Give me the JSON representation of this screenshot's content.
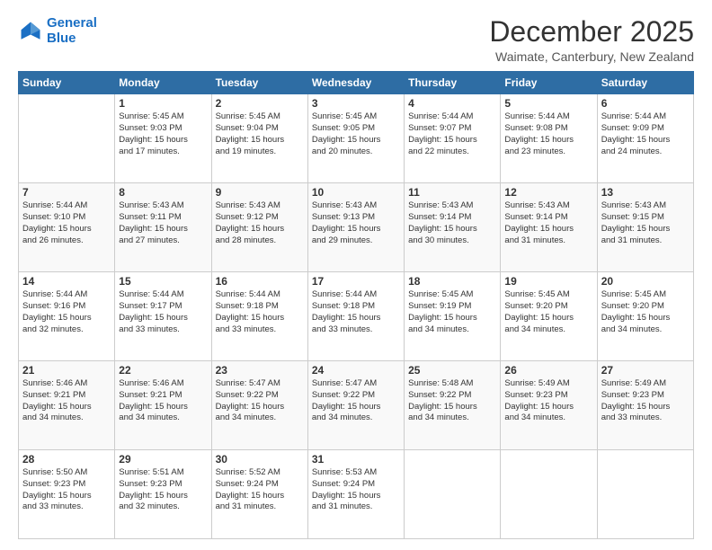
{
  "header": {
    "logo_line1": "General",
    "logo_line2": "Blue",
    "title": "December 2025",
    "subtitle": "Waimate, Canterbury, New Zealand"
  },
  "days_of_week": [
    "Sunday",
    "Monday",
    "Tuesday",
    "Wednesday",
    "Thursday",
    "Friday",
    "Saturday"
  ],
  "weeks": [
    [
      {
        "day": "",
        "content": ""
      },
      {
        "day": "1",
        "content": "Sunrise: 5:45 AM\nSunset: 9:03 PM\nDaylight: 15 hours\nand 17 minutes."
      },
      {
        "day": "2",
        "content": "Sunrise: 5:45 AM\nSunset: 9:04 PM\nDaylight: 15 hours\nand 19 minutes."
      },
      {
        "day": "3",
        "content": "Sunrise: 5:45 AM\nSunset: 9:05 PM\nDaylight: 15 hours\nand 20 minutes."
      },
      {
        "day": "4",
        "content": "Sunrise: 5:44 AM\nSunset: 9:07 PM\nDaylight: 15 hours\nand 22 minutes."
      },
      {
        "day": "5",
        "content": "Sunrise: 5:44 AM\nSunset: 9:08 PM\nDaylight: 15 hours\nand 23 minutes."
      },
      {
        "day": "6",
        "content": "Sunrise: 5:44 AM\nSunset: 9:09 PM\nDaylight: 15 hours\nand 24 minutes."
      }
    ],
    [
      {
        "day": "7",
        "content": "Sunrise: 5:44 AM\nSunset: 9:10 PM\nDaylight: 15 hours\nand 26 minutes."
      },
      {
        "day": "8",
        "content": "Sunrise: 5:43 AM\nSunset: 9:11 PM\nDaylight: 15 hours\nand 27 minutes."
      },
      {
        "day": "9",
        "content": "Sunrise: 5:43 AM\nSunset: 9:12 PM\nDaylight: 15 hours\nand 28 minutes."
      },
      {
        "day": "10",
        "content": "Sunrise: 5:43 AM\nSunset: 9:13 PM\nDaylight: 15 hours\nand 29 minutes."
      },
      {
        "day": "11",
        "content": "Sunrise: 5:43 AM\nSunset: 9:14 PM\nDaylight: 15 hours\nand 30 minutes."
      },
      {
        "day": "12",
        "content": "Sunrise: 5:43 AM\nSunset: 9:14 PM\nDaylight: 15 hours\nand 31 minutes."
      },
      {
        "day": "13",
        "content": "Sunrise: 5:43 AM\nSunset: 9:15 PM\nDaylight: 15 hours\nand 31 minutes."
      }
    ],
    [
      {
        "day": "14",
        "content": "Sunrise: 5:44 AM\nSunset: 9:16 PM\nDaylight: 15 hours\nand 32 minutes."
      },
      {
        "day": "15",
        "content": "Sunrise: 5:44 AM\nSunset: 9:17 PM\nDaylight: 15 hours\nand 33 minutes."
      },
      {
        "day": "16",
        "content": "Sunrise: 5:44 AM\nSunset: 9:18 PM\nDaylight: 15 hours\nand 33 minutes."
      },
      {
        "day": "17",
        "content": "Sunrise: 5:44 AM\nSunset: 9:18 PM\nDaylight: 15 hours\nand 33 minutes."
      },
      {
        "day": "18",
        "content": "Sunrise: 5:45 AM\nSunset: 9:19 PM\nDaylight: 15 hours\nand 34 minutes."
      },
      {
        "day": "19",
        "content": "Sunrise: 5:45 AM\nSunset: 9:20 PM\nDaylight: 15 hours\nand 34 minutes."
      },
      {
        "day": "20",
        "content": "Sunrise: 5:45 AM\nSunset: 9:20 PM\nDaylight: 15 hours\nand 34 minutes."
      }
    ],
    [
      {
        "day": "21",
        "content": "Sunrise: 5:46 AM\nSunset: 9:21 PM\nDaylight: 15 hours\nand 34 minutes."
      },
      {
        "day": "22",
        "content": "Sunrise: 5:46 AM\nSunset: 9:21 PM\nDaylight: 15 hours\nand 34 minutes."
      },
      {
        "day": "23",
        "content": "Sunrise: 5:47 AM\nSunset: 9:22 PM\nDaylight: 15 hours\nand 34 minutes."
      },
      {
        "day": "24",
        "content": "Sunrise: 5:47 AM\nSunset: 9:22 PM\nDaylight: 15 hours\nand 34 minutes."
      },
      {
        "day": "25",
        "content": "Sunrise: 5:48 AM\nSunset: 9:22 PM\nDaylight: 15 hours\nand 34 minutes."
      },
      {
        "day": "26",
        "content": "Sunrise: 5:49 AM\nSunset: 9:23 PM\nDaylight: 15 hours\nand 34 minutes."
      },
      {
        "day": "27",
        "content": "Sunrise: 5:49 AM\nSunset: 9:23 PM\nDaylight: 15 hours\nand 33 minutes."
      }
    ],
    [
      {
        "day": "28",
        "content": "Sunrise: 5:50 AM\nSunset: 9:23 PM\nDaylight: 15 hours\nand 33 minutes."
      },
      {
        "day": "29",
        "content": "Sunrise: 5:51 AM\nSunset: 9:23 PM\nDaylight: 15 hours\nand 32 minutes."
      },
      {
        "day": "30",
        "content": "Sunrise: 5:52 AM\nSunset: 9:24 PM\nDaylight: 15 hours\nand 31 minutes."
      },
      {
        "day": "31",
        "content": "Sunrise: 5:53 AM\nSunset: 9:24 PM\nDaylight: 15 hours\nand 31 minutes."
      },
      {
        "day": "",
        "content": ""
      },
      {
        "day": "",
        "content": ""
      },
      {
        "day": "",
        "content": ""
      }
    ]
  ]
}
